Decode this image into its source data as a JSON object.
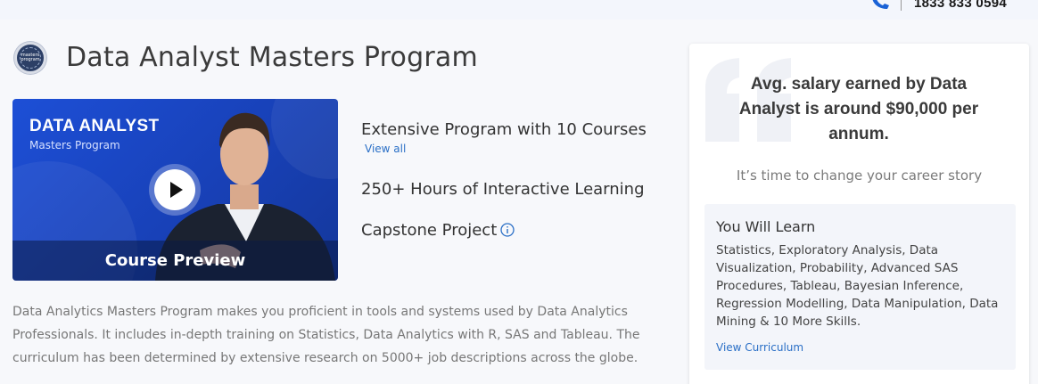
{
  "topbar": {
    "phone_number": "1833 833 0594",
    "phone_icon": "phone-icon"
  },
  "header": {
    "badge_text": "masters program",
    "title": "Data Analyst Masters Program"
  },
  "video": {
    "title": "DATA ANALYST",
    "subtitle": "Masters Program",
    "caption": "Course Preview",
    "play_icon": "play-icon"
  },
  "features": {
    "courses": "Extensive Program with 10 Courses",
    "view_all": "View all",
    "hours": "250+ Hours of Interactive Learning",
    "capstone": "Capstone Project",
    "info_icon": "info-icon"
  },
  "description": "Data Analytics Masters Program makes you proficient in tools and systems used by Data Analytics Professionals. It includes in-depth training on Statistics, Data Analytics with R, SAS and Tableau. The curriculum has been determined by extensive research on 5000+ job descriptions across the globe.",
  "card": {
    "salary_line1": "Avg. salary earned by Data",
    "salary_line2": "Analyst is around $90,000 per",
    "salary_line3": "annum.",
    "career_text": "It’s time to change your career story",
    "learn_title": "You Will Learn",
    "learn_text": "Statistics, Exploratory Analysis, Data Visualization, Probability, Advanced SAS Procedures, Tableau, Bayesian Inference, Regression Modelling, Data Manipulation, Data Mining & 10 More Skills.",
    "view_curriculum": "View Curriculum"
  },
  "colors": {
    "link": "#2a6fc6",
    "video_bg": "#1d4fd6",
    "page_bg": "#f7f8fb"
  }
}
